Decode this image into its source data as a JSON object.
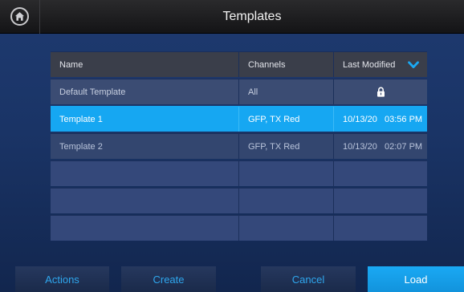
{
  "header": {
    "title": "Templates"
  },
  "table": {
    "columns": {
      "name": "Name",
      "channels": "Channels",
      "last_modified": "Last Modified"
    },
    "rows": [
      {
        "name": "Default Template",
        "channels": "All",
        "last_modified": "",
        "locked": true
      },
      {
        "name": "Template 1",
        "channels": "GFP, TX Red",
        "last_modified": "10/13/20   03:56 PM",
        "selected": true
      },
      {
        "name": "Template 2",
        "channels": "GFP, TX Red",
        "last_modified": "10/13/20   02:07 PM"
      }
    ]
  },
  "buttons": {
    "actions": "Actions",
    "create": "Create",
    "cancel": "Cancel",
    "load": "Load"
  },
  "icons": {
    "home": "home-icon",
    "sort": "chevron-down-icon",
    "lock": "lock-icon"
  },
  "colors": {
    "accent": "#16a7f2",
    "button_text": "#2fa7ee"
  }
}
